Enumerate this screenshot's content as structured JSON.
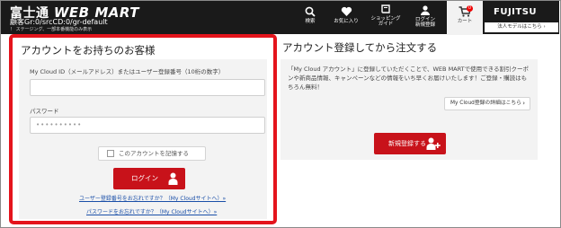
{
  "header": {
    "logo_main": "富士通",
    "logo_brand": "WEB MART",
    "sub_line1": "顧客Gr:0/srcCD:0/gr-default",
    "sub_line2": "！ ステージング、一部本番機能のみ表示",
    "nav": {
      "search": "検索",
      "favorites": "お気に入り",
      "shopping_guide": "ショッピング\nガイド",
      "login_line1": "ログイン",
      "login_line2": "新規登録",
      "cart": "カート",
      "cart_count": "0"
    },
    "fujitsu_logo": "FUJITSU",
    "corporate_model": "法人モデルはこちら ›"
  },
  "login": {
    "title": "アカウントをお持ちのお客様",
    "id_label": "My Cloud ID（メールアドレス）またはユーザー登録番号（10桁の数字）",
    "id_value": "",
    "password_label": "パスワード",
    "password_value": "••••••••••",
    "remember_label": "このアカウントを記憶する",
    "login_button": "ログイン",
    "forgot_user_link": "ユーザー登録番号をお忘れですか？（My Cloudサイトへ）»",
    "forgot_password_link": "パスワードをお忘れですか？（My Cloudサイトへ）»"
  },
  "register": {
    "title": "アカウント登録してから注文する",
    "description": "「My Cloud アカウント」に登録していただくことで、WEB MARTで使用できる割引クーポンや新商品情報、キャンペーンなどの情報をいち早くお届けいたします！ご登録・購読はもちろん無料！",
    "detail_button": "My Cloud登録の詳細はこちら",
    "register_button": "新規登録する"
  },
  "colors": {
    "header_bg": "#1a1a1a",
    "accent_red": "#c8121a",
    "highlight_border": "#e4141c",
    "link_blue": "#1a4fa8"
  }
}
